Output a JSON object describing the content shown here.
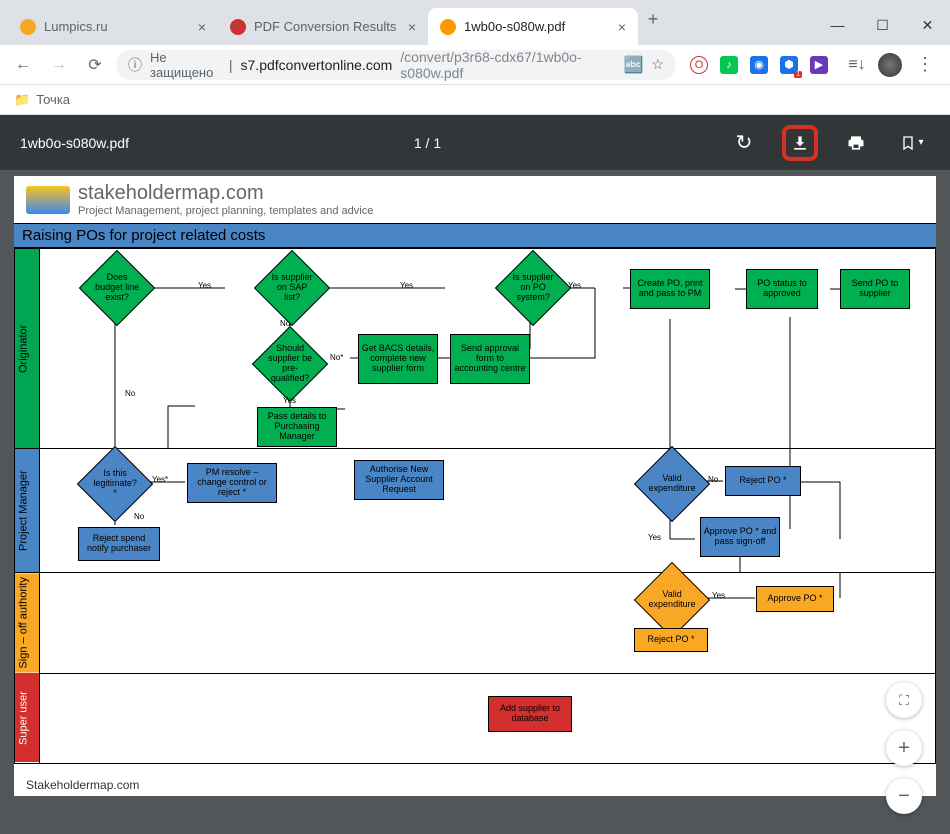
{
  "tabs": [
    {
      "title": "Lumpics.ru",
      "favcolor": "#f5a623"
    },
    {
      "title": "PDF Conversion Results",
      "favcolor": "#d32f2f",
      "favtext": "PDF"
    },
    {
      "title": "1wb0o-s080w.pdf",
      "favcolor": "#ff9800"
    }
  ],
  "addr": {
    "secure_label": "Не защищено",
    "host": "s7.pdfconvertonline.com",
    "path": "/convert/p3r68-cdx67/1wb0o-s080w.pdf"
  },
  "bookmarks": {
    "item1": "Точка"
  },
  "pdf": {
    "filename": "1wb0o-s080w.pdf",
    "page": "1 / 1"
  },
  "doc": {
    "brand": "stakeholdermap.com",
    "tagline": "Project Management, project planning, templates and advice",
    "chart_title": "Raising POs for project related costs",
    "footer": "Stakeholdermap.com",
    "lanes": {
      "originator": "Originator",
      "pm": "Project Manager",
      "signoff": "authority",
      "signoff2": "Sign – off",
      "super": "Super user"
    },
    "nodes": {
      "d_budget": "Does budget line exist?",
      "d_sap": "Is supplier on SAP list?",
      "d_posys": "Is supplier on PO system?",
      "create_po": "Create PO, print and pass to PM",
      "po_status": "PO status to approved",
      "send_po": "Send PO to supplier",
      "d_prequal": "Should supplier be pre-qualified?",
      "bacs": "Get BACS details, complete new supplier form",
      "send_approval": "Send approval form to accounting centre",
      "pass_purch": "Pass details to Purchasing Manager",
      "d_legit": "Is this legitimate? *",
      "pm_resolve": "PM resolve – change control or reject *",
      "auth_new": "Authorise New Supplier Account Request",
      "d_valid_pm": "Valid expenditure",
      "reject_po_pm": "Reject PO *",
      "approve_po_pm": "Approve PO * and pass sign-off",
      "reject_spend": "Reject spend notify purchaser",
      "d_valid_so": "Valid expenditure",
      "approve_po_so": "Approve PO *",
      "reject_po_so": "Reject PO *",
      "add_supplier": "Add supplier to database"
    },
    "labels": {
      "yes": "Yes",
      "no": "No",
      "yes_star": "Yes*",
      "no_star": "No*"
    }
  }
}
